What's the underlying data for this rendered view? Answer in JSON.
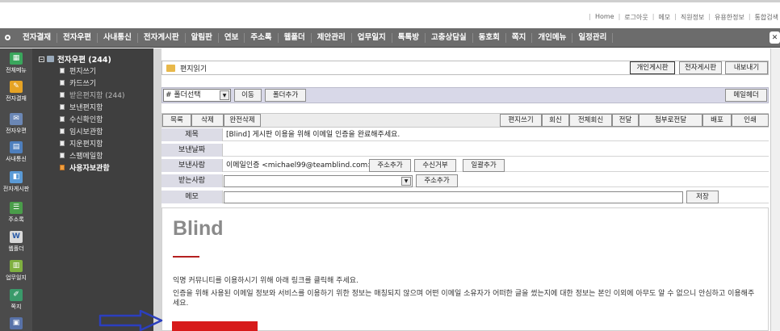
{
  "top_links": [
    "Home",
    "로그아웃",
    "메모",
    "직원정보",
    "유용한정보",
    "통합검색"
  ],
  "main_nav": [
    "전자결재",
    "전자우편",
    "사내통신",
    "전자게시판",
    "알림판",
    "연보",
    "주소록",
    "웹폴더",
    "제안관리",
    "업무일지",
    "톡톡방",
    "고충상담실",
    "동호회",
    "쪽지",
    "개인메뉴",
    "일정관리"
  ],
  "sidebar_icons": [
    {
      "label": "전체메뉴",
      "icon": "all-menu-icon",
      "color": "#3aa65c"
    },
    {
      "label": "전자결재",
      "icon": "approval-icon",
      "color": "#e6a324"
    },
    {
      "label": "전자우편",
      "icon": "mail-icon",
      "color": "#6b87b5"
    },
    {
      "label": "사내통신",
      "icon": "notice-icon",
      "color": "#4e7fbd"
    },
    {
      "label": "전자게시판",
      "icon": "board-icon",
      "color": "#5a9ad6"
    },
    {
      "label": "주소록",
      "icon": "address-book-icon",
      "color": "#4a9d4a"
    },
    {
      "label": "웹폴더",
      "icon": "web-folder-icon",
      "color": "#d9d9d9"
    },
    {
      "label": "업무일지",
      "icon": "work-log-icon",
      "color": "#7fb040"
    },
    {
      "label": "쪽지",
      "icon": "message-icon",
      "color": "#3a9a6a"
    },
    {
      "label": "",
      "icon": "more-icon",
      "color": "#5872a8"
    }
  ],
  "tree": {
    "root": "전자우편 (244)",
    "items": [
      "편지쓰기",
      "카드쓰기",
      "받은편지함 (244)",
      "보낸편지함",
      "수신확인함",
      "임시보관함",
      "지운편지함",
      "스팸메일함",
      "사용자보관함"
    ]
  },
  "header": {
    "title": "편지읽기",
    "buttons": [
      "개인게시판",
      "전자게시판",
      "내보내기"
    ]
  },
  "folder_bar": {
    "select_value": "# 폴더선택",
    "move": "이동",
    "add_folder": "폴더추가",
    "mail_header": "메일헤더"
  },
  "toolbar": {
    "left": [
      "목록",
      "삭제",
      "완전삭제"
    ],
    "right": [
      "편지쓰기",
      "회신",
      "전체회신",
      "전달",
      "첨부로전달",
      "배포",
      "인쇄"
    ]
  },
  "fields": {
    "subject_label": "제목",
    "subject": "[Blind] 게시판 이용을 위해 이메일 인증을 완료해주세요.",
    "date_label": "보낸날짜",
    "date": "",
    "sender_label": "보낸사람",
    "sender": "이메일인증 <michael99@teamblind.com>",
    "sender_buttons": [
      "주소추가",
      "수신거부",
      "일괄추가"
    ],
    "recipient_label": "받는사람",
    "recipient_add": "주소추가",
    "memo_label": "메모",
    "memo_save": "저장"
  },
  "body": {
    "brand": "Blind",
    "line1": "익명 커뮤니티를 이용하시기 위해 아래 링크를 클릭해 주세요.",
    "line2": "인증을 위해 사용된 이메일 정보와 서비스를 이용하기 위한 정보는 매칭되지 않으며 어떤 이메일 소유자가 어떠한 글을 썼는지에 대한 정보는 본인 이외에 아무도 알 수 없으니 안심하고 이용해주세요.",
    "accent_color": "#d71a1a"
  }
}
